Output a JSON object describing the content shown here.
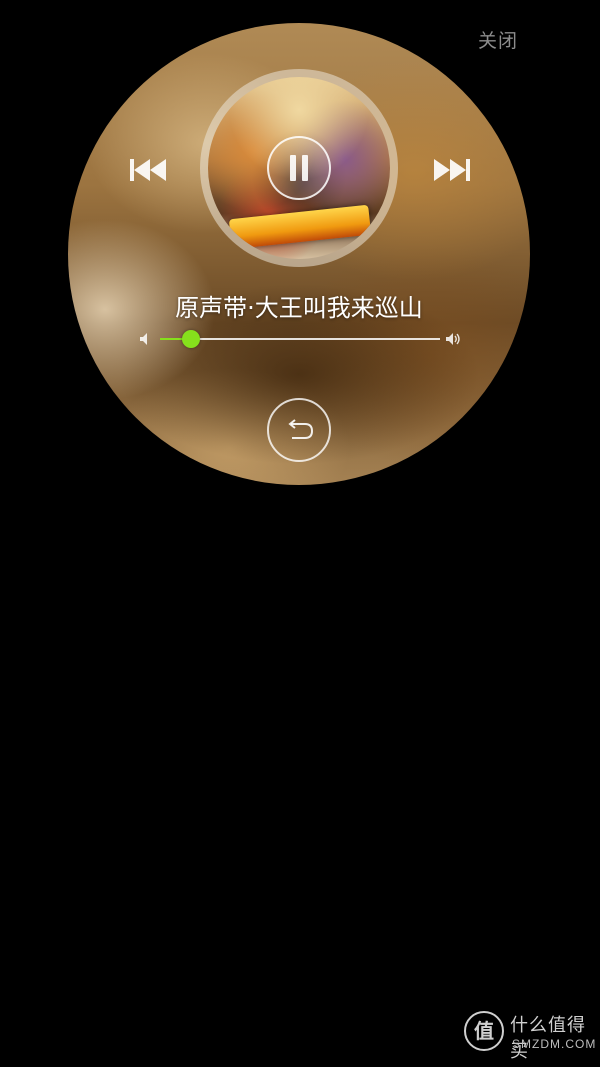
{
  "header": {
    "close_label": "关闭"
  },
  "player": {
    "song_title": "原声带·大王叫我来巡山",
    "volume_percent": 11,
    "state": "playing",
    "accent_color": "#86e01c"
  },
  "icons": {
    "prev": "previous-track-icon",
    "next": "next-track-icon",
    "pause": "pause-icon",
    "back": "back-arrow-icon",
    "volume_low": "volume-low-icon",
    "volume_high": "volume-high-icon"
  },
  "watermark": {
    "logo_char": "值",
    "site_name": "什么值得买",
    "site_domain": "SMZDM.COM"
  }
}
